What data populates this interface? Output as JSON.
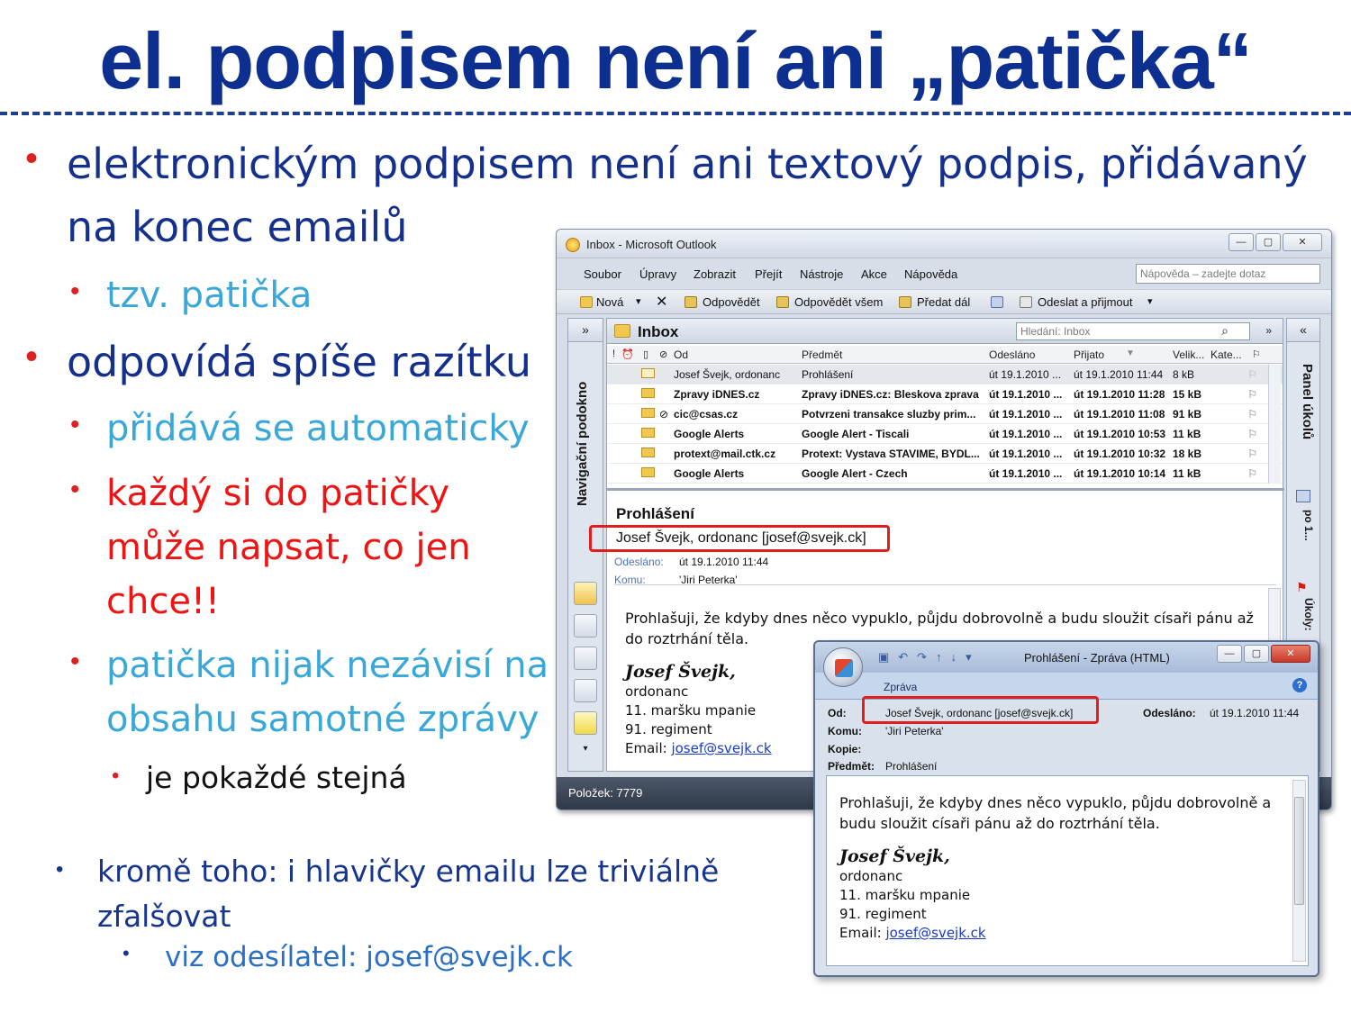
{
  "slide": {
    "title": "el. podpisem není ani „patička“",
    "bullets": {
      "b1": "elektronickým podpisem není ani textový podpis, přidávaný",
      "b1_cont": "na konec emailů",
      "b1_1": "tzv. patička",
      "b2": "odpovídá spíše razítku",
      "b2_1": "přidává se  automaticky",
      "b2_2_l1": "každý si do patičky",
      "b2_2_l2": "může napsat, co jen",
      "b2_2_l3": "chce!!",
      "b2_3_l1": "patička nijak nezávisí na",
      "b2_3_l2": "obsahu samotné zprávy",
      "b2_3_1": "je pokaždé stejná",
      "b3_l1": "kromě toho: i hlavičky emailu lze triviálně",
      "b3_l2": "zfalšovat",
      "b3_1": "viz odesílatel: josef@svejk.ck"
    },
    "colors": {
      "title": "#0d2f8f",
      "cyan": "#39a8d9",
      "red": "#ef1313",
      "highlight": "#e21d1d"
    }
  },
  "outlook": {
    "window_title": "Inbox - Microsoft Outlook",
    "window_buttons": [
      "—",
      "▢",
      "✕"
    ],
    "menu": [
      "Soubor",
      "Úpravy",
      "Zobrazit",
      "Přejít",
      "Nástroje",
      "Akce",
      "Nápověda"
    ],
    "help_placeholder": "Nápověda – zadejte dotaz",
    "toolbar": {
      "new": "Nová",
      "reply": "Odpovědět",
      "reply_all": "Odpovědět všem",
      "forward": "Předat dál",
      "send_receive": "Odeslat a přijmout"
    },
    "nav_pane_label": "Navigační podokno",
    "task_pane_label": "Panel úkolů",
    "task_pane_items": [
      "po 1...",
      "Úkoly:"
    ],
    "folder": "Inbox",
    "search_placeholder": "Hledání: Inbox",
    "columns": {
      "from": "Od",
      "subject": "Předmět",
      "sent": "Odesláno",
      "received": "Přijato",
      "size": "Velik...",
      "category": "Kate..."
    },
    "messages": [
      {
        "from": "Josef Švejk, ordonanc",
        "subject": "Prohlášení",
        "sent": "út 19.1.2010 ...",
        "received": "út 19.1.2010 11:44",
        "size": "8 kB",
        "read": true
      },
      {
        "from": "Zpravy iDNES.cz",
        "subject": "Zpravy iDNES.cz: Bleskova zprava",
        "sent": "út 19.1.2010 ...",
        "received": "út 19.1.2010 11:28",
        "size": "15 kB",
        "read": false
      },
      {
        "from": "cic@csas.cz",
        "subject": "Potvrzeni transakce sluzby prim...",
        "sent": "út 19.1.2010 ...",
        "received": "út 19.1.2010 11:08",
        "size": "91 kB",
        "read": false
      },
      {
        "from": "Google Alerts",
        "subject": "Google Alert - Tiscali",
        "sent": "út 19.1.2010 ...",
        "received": "út 19.1.2010 10:53",
        "size": "11 kB",
        "read": false
      },
      {
        "from": "protext@mail.ctk.cz",
        "subject": "Protext: Vystava STAVIME, BYDL...",
        "sent": "út 19.1.2010 ...",
        "received": "út 19.1.2010 10:32",
        "size": "18 kB",
        "read": false
      },
      {
        "from": "Google Alerts",
        "subject": "Google Alert - Czech",
        "sent": "út 19.1.2010 ...",
        "received": "út 19.1.2010 10:14",
        "size": "11 kB",
        "read": false
      }
    ],
    "preview": {
      "subject": "Prohlášení",
      "from": "Josef Švejk, ordonanc [josef@svejk.ck]",
      "sent_label": "Odesláno:",
      "sent_value": "út 19.1.2010 11:44",
      "to_label": "Komu:",
      "to_value": "'Jiri Peterka'",
      "body_l1": "Prohlašuji, že kdyby dnes něco vypuklo, půjdu dobrovolně a budu sloužit císaři pánu až",
      "body_l2": "do roztrhání těla.",
      "sig_name": "Josef Švejk,",
      "sig_l1": "ordonanc",
      "sig_l2": "11. maršku mpanie",
      "sig_l3": "91. regiment",
      "sig_email_label": "Email:",
      "sig_email": "josef@svejk.ck"
    },
    "status": "Položek: 7779"
  },
  "message_window": {
    "title": "Prohlášení - Zpráva (HTML)",
    "ribbon_tab": "Zpráva",
    "from_label": "Od:",
    "from_value": "Josef Švejk, ordonanc [josef@svejk.ck]",
    "sent_label": "Odesláno:",
    "sent_value": "út 19.1.2010 11:44",
    "to_label": "Komu:",
    "to_value": "'Jiri Peterka'",
    "cc_label": "Kopie:",
    "subject_label": "Předmět:",
    "subject_value": "Prohlášení",
    "body_l1": "Prohlašuji, že kdyby dnes něco vypuklo, půjdu dobrovolně a",
    "body_l2": "budu sloužit císaři pánu až do roztrhání těla.",
    "sig_name": "Josef Švejk,",
    "sig_l1": "ordonanc",
    "sig_l2": "11. maršku mpanie",
    "sig_l3": "91. regiment",
    "sig_email_label": "Email:",
    "sig_email": "josef@svejk.ck"
  }
}
